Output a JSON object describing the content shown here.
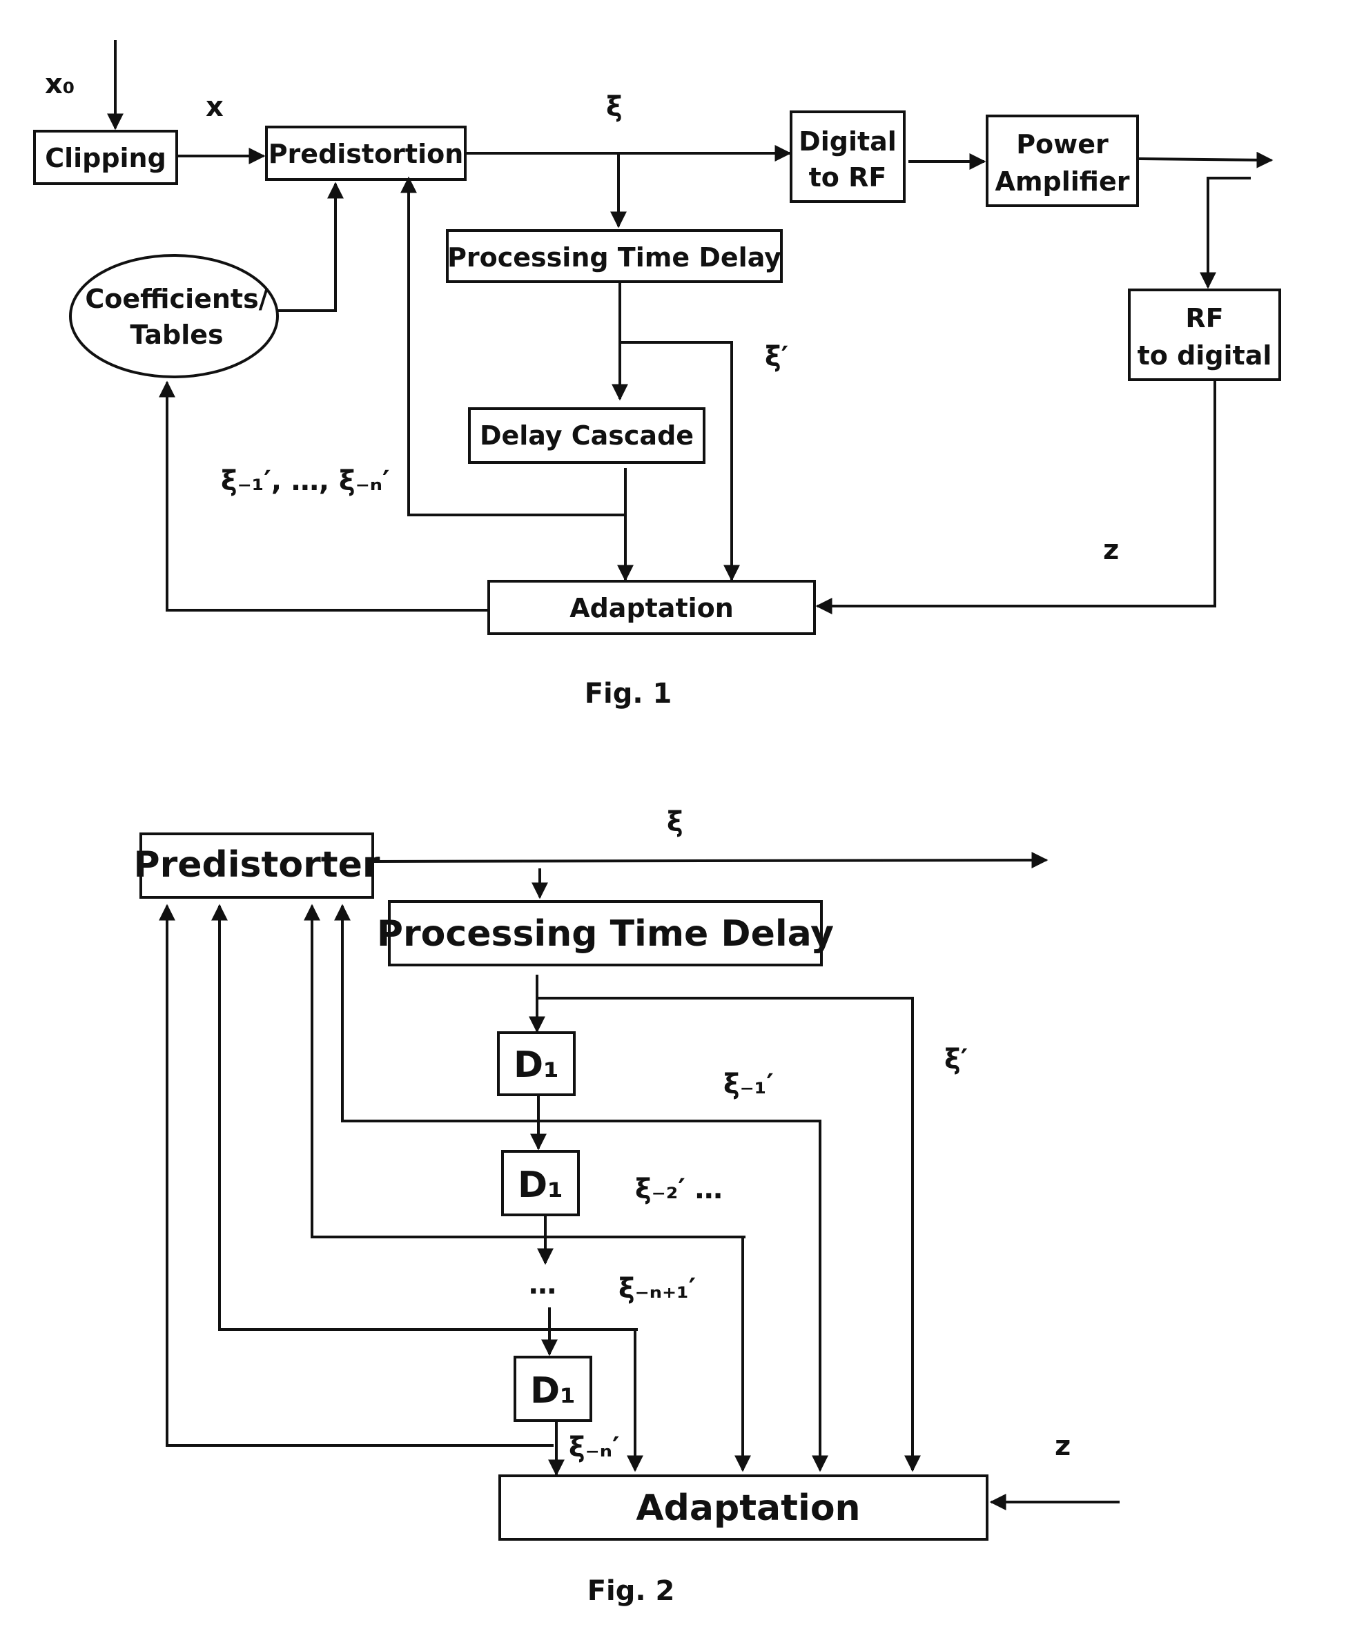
{
  "fig1": {
    "caption": "Fig. 1",
    "blocks": {
      "clipping": "Clipping",
      "predistortion": "Predistortion",
      "digital_to_rf_1": "Digital",
      "digital_to_rf_2": "to RF",
      "power_amplifier_1": "Power",
      "power_amplifier_2": "Amplifier",
      "processing_time_delay": "Processing Time Delay",
      "coefficients_1": "Coefficients/",
      "coefficients_2": "Tables",
      "rf_to_digital_1": "RF",
      "rf_to_digital_2": "to digital",
      "delay_cascade": "Delay Cascade",
      "adaptation": "Adaptation"
    },
    "signals": {
      "x0": "x₀",
      "x": "x",
      "xi": "ξ",
      "xi_prime": "ξ′",
      "xi_delayed": "ξ₋₁′, …, ξ₋ₙ′",
      "z": "z"
    }
  },
  "fig2": {
    "caption": "Fig. 2",
    "blocks": {
      "predistorter": "Predistorter",
      "processing_time_delay": "Processing Time Delay",
      "d1_a": "D₁",
      "d1_b": "D₁",
      "d1_c": "D₁",
      "ellipsis": "…",
      "adaptation": "Adaptation"
    },
    "signals": {
      "xi": "ξ",
      "xi_prime": "ξ′",
      "xi_m1": "ξ₋₁′",
      "xi_m2": "ξ₋₂′ …",
      "xi_mn1": "ξ₋ₙ₊₁′",
      "xi_mn": "ξ₋ₙ′",
      "z": "z"
    }
  }
}
